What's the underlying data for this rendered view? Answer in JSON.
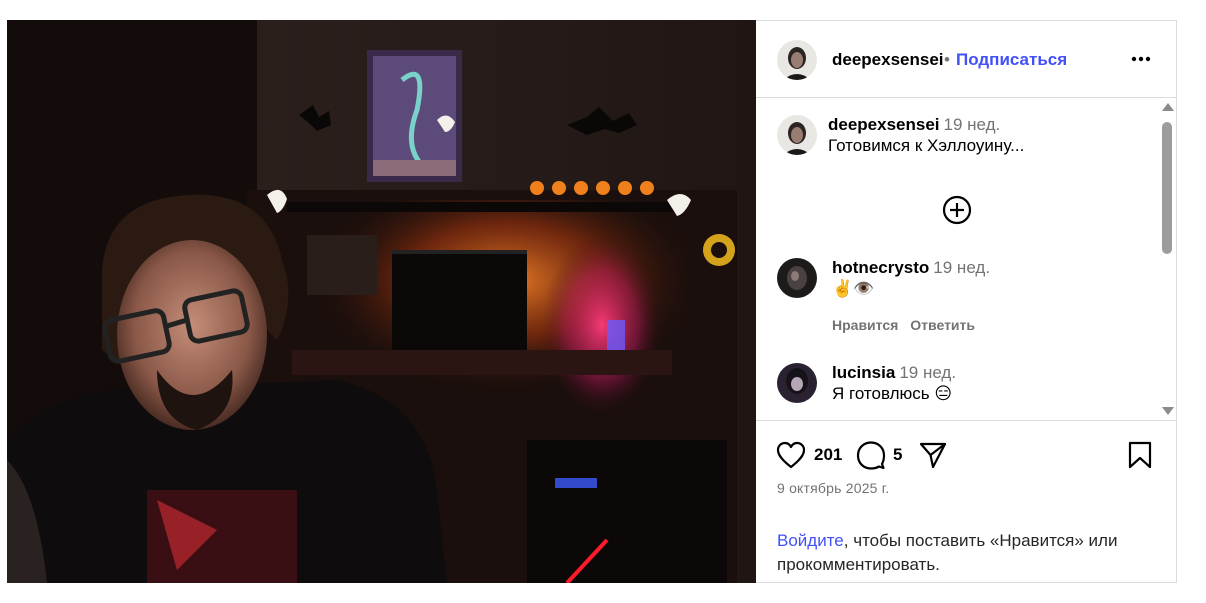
{
  "post": {
    "username": "deepexsensei",
    "separator": "•",
    "follow_label": "Подписаться",
    "more_icon": "more-horizontal-icon",
    "image_alt_icon": "post-photo"
  },
  "comments": [
    {
      "username": "deepexsensei",
      "time": "19 нед.",
      "text": "Готовимся к Хэллоуину..."
    },
    {
      "username": "hotnecrysto",
      "time": "19 нед.",
      "text": "✌️👁️",
      "like_label": "Нравится",
      "reply_label": "Ответить"
    },
    {
      "username": "lucinsia",
      "time": "19 нед.",
      "text": "Я готовлюсь 😑"
    }
  ],
  "load_more_icon": "plus-circle-icon",
  "engagement": {
    "likes": "201",
    "comments": "5",
    "date": "9 октябрь 2025 г."
  },
  "login_prompt": {
    "link": "Войдите",
    "rest": ", чтобы поставить «Нравится» или прокомментировать."
  },
  "colors": {
    "accent": "#4150f7",
    "muted": "#737373",
    "border": "#dbdbdb"
  }
}
